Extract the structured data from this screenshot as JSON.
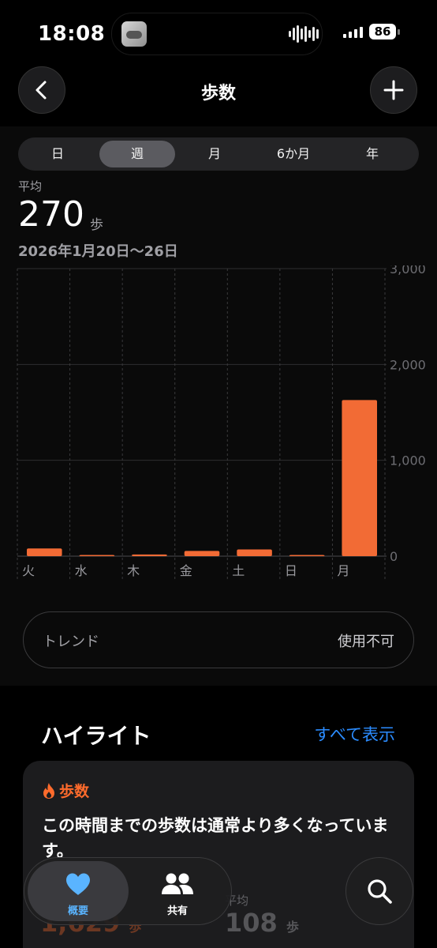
{
  "status_bar": {
    "time": "18:08",
    "battery": "86"
  },
  "nav": {
    "title": "歩数"
  },
  "segments": [
    "日",
    "週",
    "月",
    "6か月",
    "年"
  ],
  "summary": {
    "label": "平均",
    "value": "270",
    "unit": "歩",
    "date_range": "2026年1月20日〜26日"
  },
  "chart_data": {
    "type": "bar",
    "categories": [
      "火",
      "水",
      "木",
      "金",
      "土",
      "日",
      "月"
    ],
    "values": [
      80,
      3,
      18,
      55,
      70,
      3,
      1629
    ],
    "ylim": [
      0,
      3000
    ],
    "y_ticks": [
      "0",
      "1,000",
      "2,000",
      "3,000"
    ],
    "y_tick_values": [
      0,
      1000,
      2000,
      3000
    ],
    "bar_color": "#f26b35",
    "grid": true
  },
  "trend": {
    "label": "トレンド",
    "value": "使用不可"
  },
  "highlights": {
    "title": "ハイライト",
    "show_all": "すべて表示",
    "card": {
      "category": "歩数",
      "text": "この時間までの歩数は通常より多くなっています。",
      "stat1_value": "1,629",
      "stat1_unit": "歩",
      "stat2_label": "平均",
      "stat2_value": "108",
      "stat2_unit": "歩"
    }
  },
  "tabbar": {
    "summary": "概要",
    "sharing": "共有"
  },
  "colors": {
    "accent": "#f26b35",
    "link": "#2b8cff",
    "heart": "#5ab4ff"
  }
}
